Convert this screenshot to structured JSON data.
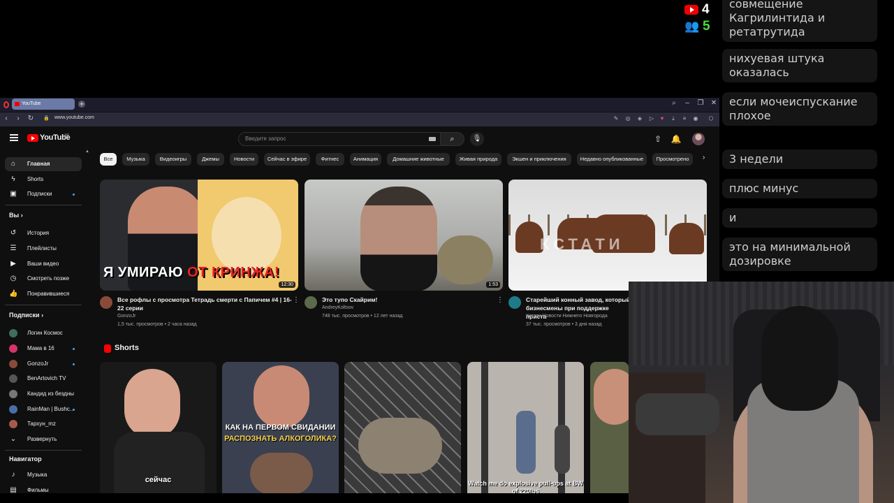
{
  "overlay": {
    "youtube_count": "4",
    "viewer_count": "5",
    "chat": [
      {
        "text": "совмещение Кагрилинтида и ретатрутида"
      },
      {
        "text": "нихуевая штука оказалась"
      },
      {
        "text": "если мочеиспускание плохое"
      },
      {
        "text": "3 недели"
      },
      {
        "text": "плюс минус"
      },
      {
        "text": "и"
      },
      {
        "text": "это на минимальной дозировке"
      }
    ]
  },
  "browser": {
    "tab_title": "YouTube",
    "url": "www.youtube.com"
  },
  "youtube": {
    "logo": "YouTube",
    "region": "AR",
    "search_placeholder": "Введите запрос",
    "sidebar": {
      "main": [
        {
          "label": "Главная",
          "icon": "home-icon",
          "active": true
        },
        {
          "label": "Shorts",
          "icon": "shorts-icon"
        },
        {
          "label": "Подписки",
          "icon": "subscriptions-icon"
        }
      ],
      "you_header": "Вы",
      "you": [
        {
          "label": "История",
          "icon": "history-icon"
        },
        {
          "label": "Плейлисты",
          "icon": "playlists-icon"
        },
        {
          "label": "Ваши видео",
          "icon": "your-videos-icon"
        },
        {
          "label": "Смотреть позже",
          "icon": "watch-later-icon"
        },
        {
          "label": "Понравившиеся",
          "icon": "like-icon"
        }
      ],
      "subs_header": "Подписки",
      "subs": [
        {
          "label": "Логин Космос",
          "color": "#3f6e5e",
          "dot": false
        },
        {
          "label": "Мама в 16",
          "color": "#d6336c",
          "dot": true
        },
        {
          "label": "GonzoJr",
          "color": "#8a4a3a",
          "dot": true
        },
        {
          "label": "BenArtovich TV",
          "color": "#555555",
          "dot": false
        },
        {
          "label": "Кандид из бездны",
          "color": "#777777",
          "dot": false
        },
        {
          "label": "RainMan | Bushc...",
          "color": "#4a6ea8",
          "dot": true
        },
        {
          "label": "Тархун_mz",
          "color": "#a85a4a",
          "dot": false
        }
      ],
      "expand": "Развернуть",
      "nav_header": "Навигатор",
      "nav": [
        {
          "label": "Музыка",
          "icon": "music-icon"
        },
        {
          "label": "Фильмы",
          "icon": "movies-icon"
        }
      ]
    },
    "chips": [
      "Все",
      "Музыка",
      "Видеоигры",
      "Джемы",
      "Новости",
      "Сейчас в эфире",
      "Фитнес",
      "Анимация",
      "Домашние животные",
      "Живая природа",
      "Экшен и приключения",
      "Недавно опубликованные",
      "Просмотрено"
    ],
    "videos": [
      {
        "title": "Все рофлы с просмотра Тетрадь смерти с Папичем #4 | 16-22 серии",
        "channel": "GonzoJr",
        "meta": "1,5 тыс. просмотров • 2 часа назад",
        "duration": "12:30",
        "thumb_caption_a": "Я УМИРАЮ ",
        "thumb_caption_b": "ОТ КРИНЖА!"
      },
      {
        "title": "Это тупо Скайрим!",
        "channel": "AndreyKoltsov",
        "meta": "748 тыс. просмотров • 12 лет назад",
        "duration": "1:53"
      },
      {
        "title": "Старейший конный завод, который бизнесмены при поддержке приста",
        "channel": "Кстати Новости Нижнего Новгорода",
        "meta": "37 тыс. просмотров • 3 дня назад",
        "watermark": "КСТАТИ"
      }
    ],
    "shorts_header": "Shorts",
    "shorts": [
      {
        "caption": "сейчас"
      },
      {
        "caption_top": "КАК НА ПЕРВОМ СВИДАНИИ",
        "caption_bottom": "РАСПОЗНАТЬ АЛКОГОЛИКА?"
      },
      {
        "caption": ""
      },
      {
        "caption": "Watch me do explosive pull-ups at BW of 220lbs"
      },
      {
        "caption": ""
      }
    ]
  }
}
